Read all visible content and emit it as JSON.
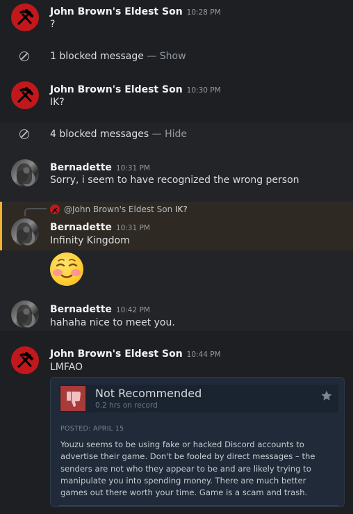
{
  "messages": [
    {
      "author": "John Brown's Eldest Son",
      "time": "10:28 PM",
      "text": "?"
    },
    {
      "author": "John Brown's Eldest Son",
      "time": "10:30 PM",
      "text": "IK?"
    },
    {
      "author": "Bernadette",
      "time": "10:31 PM",
      "text": "Sorry, i seem to have recognized the wrong person"
    },
    {
      "author": "Bernadette",
      "time": "10:31 PM",
      "text": "Infinity Kingdom"
    },
    {
      "author": "Bernadette",
      "time": "10:42 PM",
      "text": "hahaha nice to meet you."
    },
    {
      "author": "John Brown's Eldest Son",
      "time": "10:44 PM",
      "text": "LMFAO"
    }
  ],
  "blocked": [
    {
      "text": "1 blocked message",
      "sep": " — ",
      "action": "Show"
    },
    {
      "text": "4 blocked messages",
      "sep": " — ",
      "action": "Hide"
    }
  ],
  "reply": {
    "mention": "@John Brown's Eldest Son",
    "snippet": "IK?"
  },
  "emoji": "relieved-blushing-face",
  "embed": {
    "title": "Not Recommended",
    "hours": "0.2 hrs on record",
    "posted": "POSTED: APRIL 15",
    "lines": [
      "Youzu seems to be using fake or hacked Discord accounts to",
      "advertise their game. Don't be fooled by direct messages – the",
      "senders are not who they appear to be and are likely trying to",
      "manipulate you into spending money. There are much better",
      "games out there worth your time. Game is a scam and trash."
    ]
  },
  "colors": {
    "background": "#1e1f22",
    "avatar_red": "#c2181b",
    "reply_accent": "#f0b232",
    "thumb_red": "#a83a3a",
    "embed_bg": "#202a38"
  }
}
